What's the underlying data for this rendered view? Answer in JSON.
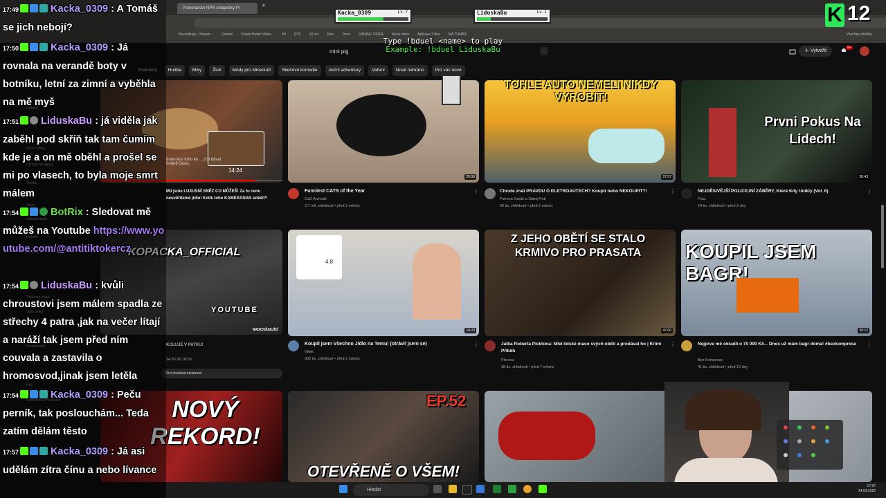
{
  "browser": {
    "tab_title": "Pomeranian NPR chlapošky Pl",
    "bookmarks": [
      "Recordings - Stream...",
      "Gemini",
      "Create Better Video...",
      "IN",
      "DTF",
      "10 vid",
      "Jobs",
      "Dnes",
      "DARING VIDEA",
      "Nová videa",
      "Aplikace 3 dna",
      "MA TOMÁŠ",
      "Všechny záložky"
    ]
  },
  "overlay": {
    "duel": {
      "left_name": "Kacka_0309",
      "left_level": "Lv.7",
      "left_hp": 0.65,
      "right_name": "LiduskaBu",
      "right_level": "Lv.1",
      "right_hp": 0.2,
      "instruction": "Type !bduel <name> to play",
      "example": "Example: !bduel LiduskaBu"
    },
    "k_badge": "K",
    "k_count": "12"
  },
  "youtube": {
    "search_query": "mini pig",
    "create_label": "Vytvořit",
    "notification_count": "9+",
    "chips": [
      "Podcasty",
      "Hudba",
      "Mixy",
      "Živě",
      "Módy pro Minecraft",
      "Skečové komedie",
      "Akční adventury",
      "Vaření",
      "Nově nahráno",
      "Pro vás nové"
    ],
    "sidebar": [
      "Odběry",
      "Noční Míšky",
      "DETEKTIV MIKS",
      "Tvorba",
      "Streik",
      "Zobrazit další",
      "Historie",
      "Playlisty",
      "Oblíbená videa",
      "Vaše videa",
      "Prozkoumat",
      "Hey",
      "Další videa z YouTube"
    ],
    "left_column": {
      "preview_time": "14:24",
      "preview_text": "bram kus toho ke ... ji si dával hodně často,",
      "video1_title": "Mil jsme LUXUSNÍ SNĚZ CO MŮŽEŠ! Za tu cenu neuvěřitelné jídlo! Kolik toho KAMERANAN snědl?!",
      "video2_overlay": "KOPACKA_OFFICIAL",
      "video2_label": "YOUTUBE",
      "video2_tag": "NADCHÁZEJÍCÍ",
      "video2_title": "KOLUJE V PATKU!",
      "video2_date": "24.03.26 18:00",
      "notify_label": "Chci dostávat oznámení",
      "video3_overlay": "NOVÝ REKORD!"
    },
    "videos": [
      {
        "title": "Funniest CATS of the Year",
        "channel": "CaD Animals",
        "meta": "3,7 mil. zhlédnutí • před 2 měsíci",
        "duration": "20:09",
        "overlay": "",
        "av": "#c0392b"
      },
      {
        "title": "Chcete znát PRAVDU O ELETROAUTECH? Koupit nebo NEKOUPIT?!",
        "channel": "Fotrova Garáž a Starej Fotr",
        "meta": "60 tis. zhlédnutí • před 2 měsíci",
        "duration": "27:27",
        "overlay": "TOHLE AUTO NEMĚLI NIKDY VYROBIT!",
        "av": "#777"
      },
      {
        "title": "NEJDĚSIVĚJŠÍ POLICEJNÍ ZÁBĚRY, Které Kdy Unikly (Vol. 6)",
        "channel": "Frizz",
        "meta": "24 tis. zhlédnutí • před 3 dny",
        "duration": "30:43",
        "overlay": "Prvni Pokus Na Lidech!",
        "av": "#222"
      },
      {
        "title": "Koupil jsem Všechno Jídlo na Temu! (otrávil jsem se)",
        "channel": "Vítek",
        "meta": "302 tis. zhlédnutí • před 2 měsíci",
        "duration": "10:20",
        "overlay": "4.8",
        "av": "#5a7fa8"
      },
      {
        "title": "Jatka Roberta Picktona: Mlel lidské maso svých obětí a prodával ho | Krimi Příběh",
        "channel": "Pitevna",
        "meta": "38 tis. zhlédnutí • před 7 měsíci",
        "duration": "47:00",
        "overlay": "Z JEHO OBĚTÍ SE STALO KRMIVO PRO PRASATA",
        "av": "#8b2b2b"
      },
      {
        "title": "Nejprve mě okradli o 70 000 Kč... Dnes už mám bagr doma! #bezkomprese",
        "channel": "Bez Komprese",
        "meta": "41 tis. zhlédnutí • před 12 dny",
        "duration": "20:12",
        "overlay": "KOUPIL JSEM BAGR!",
        "av": "#c9a13b"
      },
      {
        "title": "",
        "channel": "",
        "meta": "",
        "duration": "",
        "overlay": "OTEVŘENĚ O VŠEM!",
        "tag": "EP.52",
        "av": "#444"
      }
    ]
  },
  "chat": [
    {
      "time": "17:49",
      "user": "Kacka_0309",
      "user_color": "#b39bff",
      "text": ": A Tomáš se jich nebojí?"
    },
    {
      "time": "17:50",
      "user": "Kacka_0309",
      "user_color": "#b39bff",
      "text": ": Já rovnala na verandě boty v botníku, letní za zimní a vyběhla na mě myš"
    },
    {
      "time": "17:51",
      "user": "LiduskaBu",
      "user_color": "#c99bff",
      "text": ": já viděla jak zaběhl pod skříň tak tam čumím kde je a on mě oběhl a prošel se mi po vlasech, to byla moje smrt málem"
    },
    {
      "time": "17:54",
      "user": "BotRix",
      "user_color": "#6de04a",
      "text": ": Sledovat mě můžeš na Youtube",
      "link": "https://www.youtube.com/@antitiktokercz"
    },
    {
      "time": "17:54",
      "user": "LiduskaBu",
      "user_color": "#c99bff",
      "text": ": kvůli chroustovi jsem málem spadla ze střechy 4 patra ,jak na večer lítají a naráží tak jsem před ním couvala a zastavila o hromosvod,jinak jsem letěla"
    },
    {
      "time": "17:54",
      "user": "Kacka_0309",
      "user_color": "#b39bff",
      "text": ": Peču perník, tak poslouchám... Teda zatím dělám těsto"
    },
    {
      "time": "17:57",
      "user": "Kacka_0309",
      "user_color": "#b39bff",
      "text": ": Já asi udělám zítra čínu a nebo lívance"
    }
  ],
  "taskbar": {
    "search_placeholder": "Hledat",
    "time": "17:57",
    "date": "24.03.2026"
  }
}
